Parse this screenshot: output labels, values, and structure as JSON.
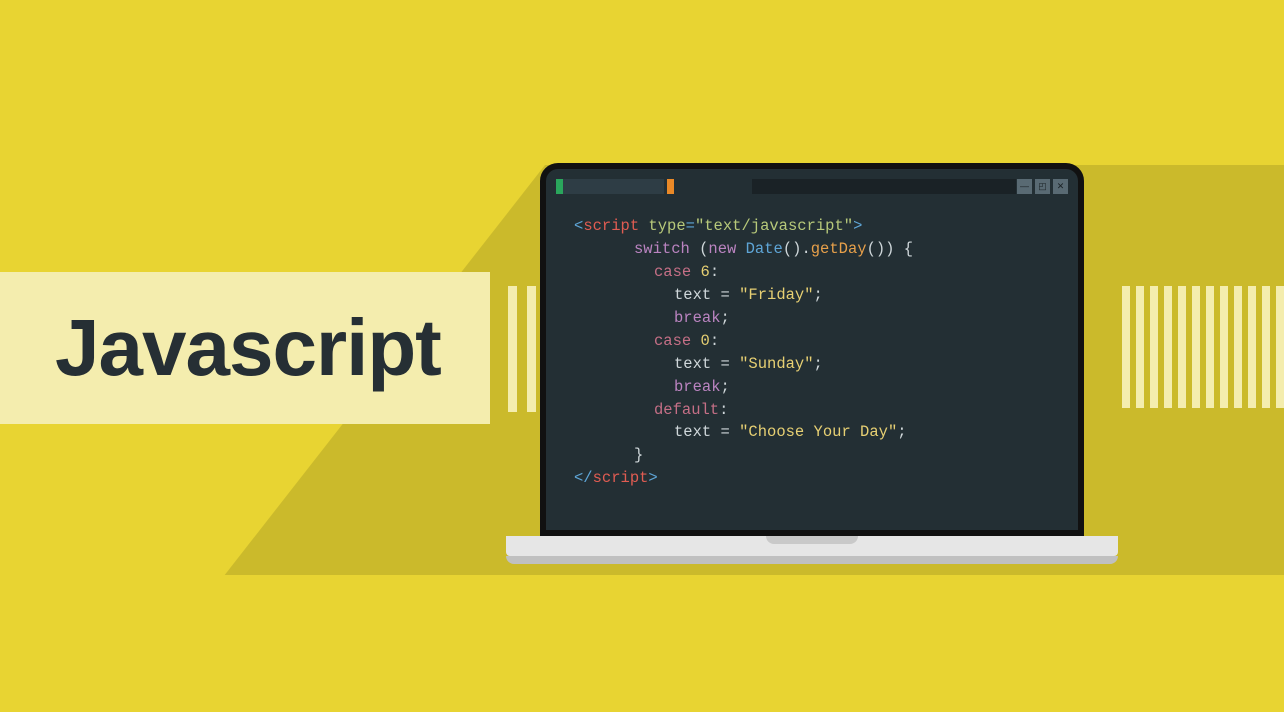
{
  "title": "Javascript",
  "code": {
    "l1": {
      "open": "<",
      "tag": "script",
      "attrname": " type",
      "eq": "=",
      "attrval": "\"text/javascript\"",
      "close": ">"
    },
    "l2": {
      "kw": "switch",
      "paren_open": " (",
      "new": "new",
      "cls": " Date",
      "mid": "().",
      "meth": "getDay",
      "after": "()) {"
    },
    "l3": {
      "case": "case",
      "num": " 6",
      "colon": ":"
    },
    "l4": {
      "var": "text",
      "op": " = ",
      "str": "\"Friday\"",
      "semi": ";"
    },
    "l5": {
      "kw": "break",
      "semi": ";"
    },
    "l6": {
      "case": "case",
      "num": " 0",
      "colon": ":"
    },
    "l7": {
      "var": "text",
      "op": " = ",
      "str": "\"Sunday\"",
      "semi": ";"
    },
    "l8": {
      "kw": "break",
      "semi": ";"
    },
    "l9": {
      "kw": "default",
      "colon": ":"
    },
    "l10": {
      "var": "text",
      "op": " = ",
      "str": "\"Choose Your Day\"",
      "semi": ";"
    },
    "l11": {
      "brace": "}"
    },
    "l12": {
      "open": "</",
      "tag": "script",
      "close": ">"
    }
  },
  "window_buttons": {
    "min": "—",
    "max": "◰",
    "close": "✕"
  }
}
